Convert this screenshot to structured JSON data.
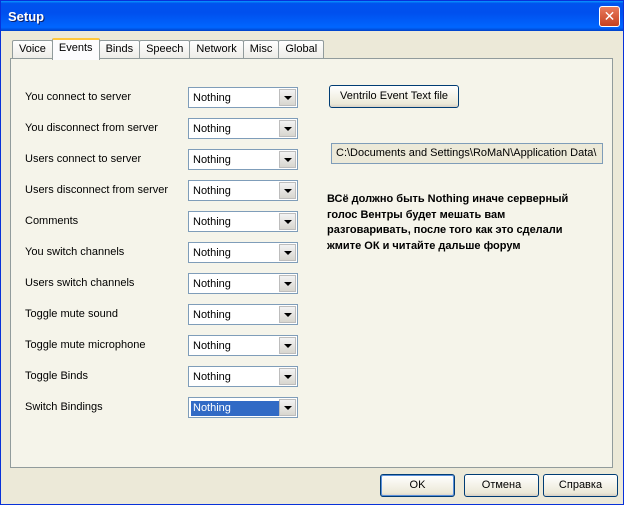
{
  "window": {
    "title": "Setup"
  },
  "tabs": [
    "Voice",
    "Events",
    "Binds",
    "Speech",
    "Network",
    "Misc",
    "Global"
  ],
  "events": [
    {
      "label": "You connect to server",
      "value": "Nothing"
    },
    {
      "label": "You disconnect from server",
      "value": "Nothing"
    },
    {
      "label": "Users connect to server",
      "value": "Nothing"
    },
    {
      "label": "Users disconnect from server",
      "value": "Nothing"
    },
    {
      "label": "Comments",
      "value": "Nothing"
    },
    {
      "label": "You switch channels",
      "value": "Nothing"
    },
    {
      "label": "Users switch channels",
      "value": "Nothing"
    },
    {
      "label": "Toggle mute sound",
      "value": "Nothing"
    },
    {
      "label": "Toggle mute microphone",
      "value": "Nothing"
    },
    {
      "label": "Toggle Binds",
      "value": "Nothing"
    },
    {
      "label": "Switch Bindings",
      "value": "Nothing"
    }
  ],
  "event_text_button": "Ventrilo Event Text file",
  "path": "C:\\Documents and Settings\\RoMaN\\Application Data\\",
  "note": "ВСё должно быть Nothing иначе серверный голос Вентры будет мешать вам разговаривать, после того как это сделали жмите ОК и читайте дальше форум",
  "buttons": {
    "ok": "OK",
    "cancel": "Отмена",
    "help": "Справка"
  }
}
